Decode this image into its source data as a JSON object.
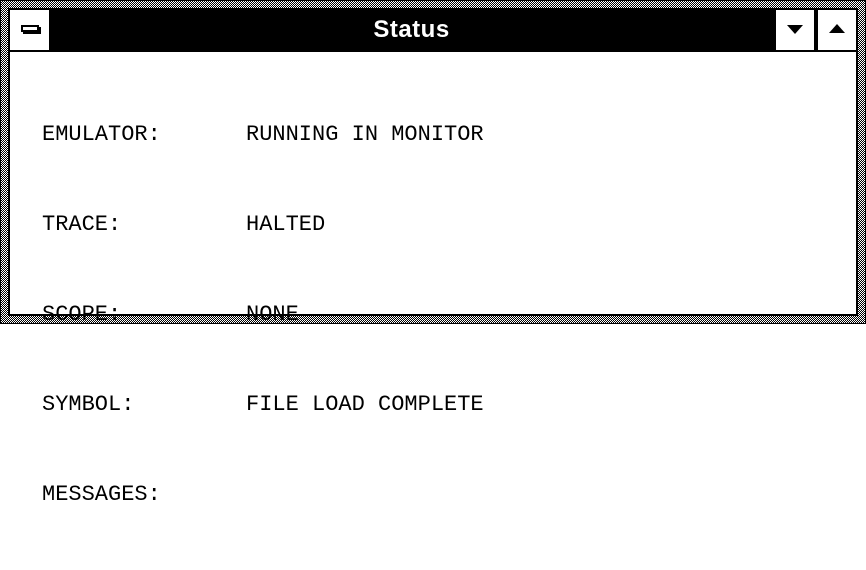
{
  "window": {
    "title": "Status"
  },
  "titlebar": {
    "system_menu_icon": "system-menu-icon",
    "minimize_icon": "minimize-arrow-icon",
    "maximize_icon": "maximize-arrow-icon"
  },
  "status": {
    "rows": [
      {
        "label": "EMULATOR:",
        "value": "RUNNING IN MONITOR"
      },
      {
        "label": "TRACE:",
        "value": "HALTED"
      },
      {
        "label": "SCOPE:",
        "value": "NONE"
      },
      {
        "label": "SYMBOL:",
        "value": "FILE LOAD COMPLETE"
      },
      {
        "label": "MESSAGES:",
        "value": ""
      }
    ]
  }
}
